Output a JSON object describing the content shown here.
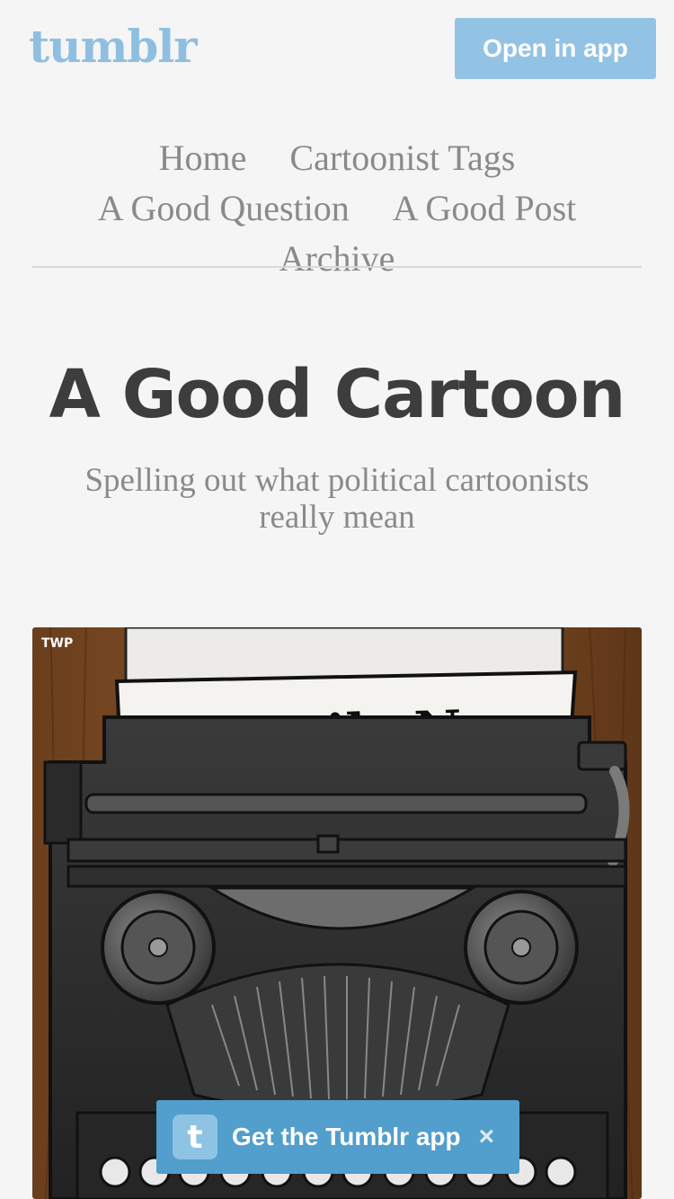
{
  "header": {
    "logo": "tumblr",
    "open_in_app": "Open in app"
  },
  "nav": {
    "items": [
      "Home",
      "Cartoonist Tags",
      "A Good Question",
      "A Good Post",
      "Archive"
    ]
  },
  "blog": {
    "title": "A Good Cartoon",
    "description": "Spelling out what political cartoonists really mean"
  },
  "post": {
    "image": {
      "watermark": "TWP",
      "newspaper_masthead": "The Daily News"
    }
  },
  "banner": {
    "icon_letter": "t",
    "label": "Get the Tumblr app",
    "close": "×"
  },
  "colors": {
    "background": "#f5f5f5",
    "accent": "#529ecc",
    "logo": "#8fbfe0"
  }
}
